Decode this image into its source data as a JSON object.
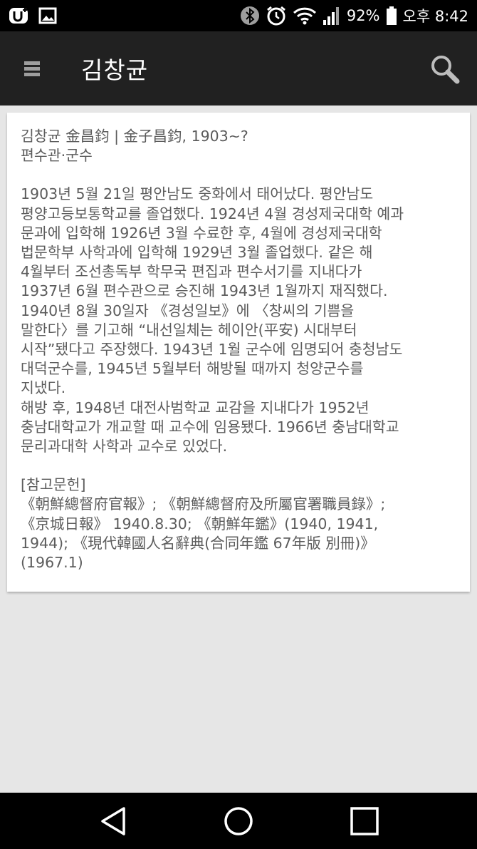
{
  "status_bar": {
    "battery_percent": "92%",
    "time": "오후 8:42",
    "icons": [
      "uplus-icon",
      "gallery-icon",
      "bluetooth-icon",
      "alarm-icon",
      "wifi-icon",
      "signal-icon",
      "battery-icon"
    ]
  },
  "app_bar": {
    "title": "김창균",
    "menu_icon": "hamburger-menu-icon",
    "search_icon": "search-icon"
  },
  "article": {
    "heading_line1": "김창균 金昌鈞 | 金子昌鈞, 1903~?",
    "heading_line2": "편수관·군수",
    "body_paragraph1": "1903년 5월 21일 평안남도 중화에서 태어났다. 평안남도\n평양고등보통학교를 졸업했다. 1924년 4월 경성제국대학 예과\n문과에 입학해 1926년 3월 수료한 후, 4월에 경성제국대학\n법문학부 사학과에 입학해 1929년 3월 졸업했다. 같은 해\n4월부터 조선총독부 학무국 편집과 편수서기를 지내다가\n1937년 6월 편수관으로 승진해 1943년 1월까지 재직했다.\n1940년 8월 30일자 《경성일보》에 〈창씨의 기쁨을\n말한다〉를 기고해 “내선일체는 헤이안(平安) 시대부터\n시작”됐다고 주장했다. 1943년 1월 군수에 임명되어 충청남도\n대덕군수를, 1945년 5월부터 해방될 때까지 청양군수를\n지냈다.",
    "body_paragraph2": "해방 후, 1948년 대전사범학교 교감을 지내다가 1952년\n충남대학교가 개교할 때 교수에 임용됐다. 1966년 충남대학교\n문리과대학 사학과 교수로 있었다.",
    "references_label": "[참고문헌]",
    "references_text": "《朝鮮總督府官報》; 《朝鮮總督府及所屬官署職員錄》;\n《京城日報》 1940.8.30; 《朝鮮年鑑》(1940, 1941,\n1944); 《現代韓國人名辭典(合同年鑑 67年版 別冊)》\n(1967.1)"
  },
  "nav_bar": {
    "back_icon": "back-triangle-icon",
    "home_icon": "home-circle-icon",
    "recents_icon": "recents-square-icon"
  }
}
